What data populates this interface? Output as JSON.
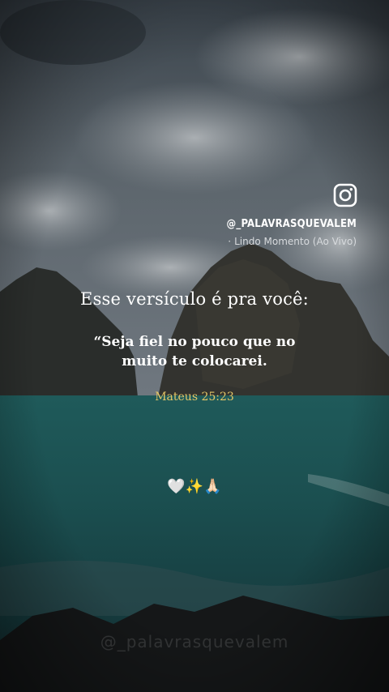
{
  "overlay": {
    "instagram_handle": "@_PALAVRASQUEVALEM",
    "song_title": "Lindo Momento (Ao Vivo)",
    "watermark": "@_palavrasquevalem"
  },
  "post": {
    "lead_text": "Esse versículo é pra você:",
    "verse_line1": "“Seja fiel no pouco que no",
    "verse_line2": "muito te colocarei.",
    "reference": "Mateus 25:23",
    "emojis": "🤍✨🙏🏻"
  },
  "icons": {
    "instagram": "instagram-icon"
  }
}
